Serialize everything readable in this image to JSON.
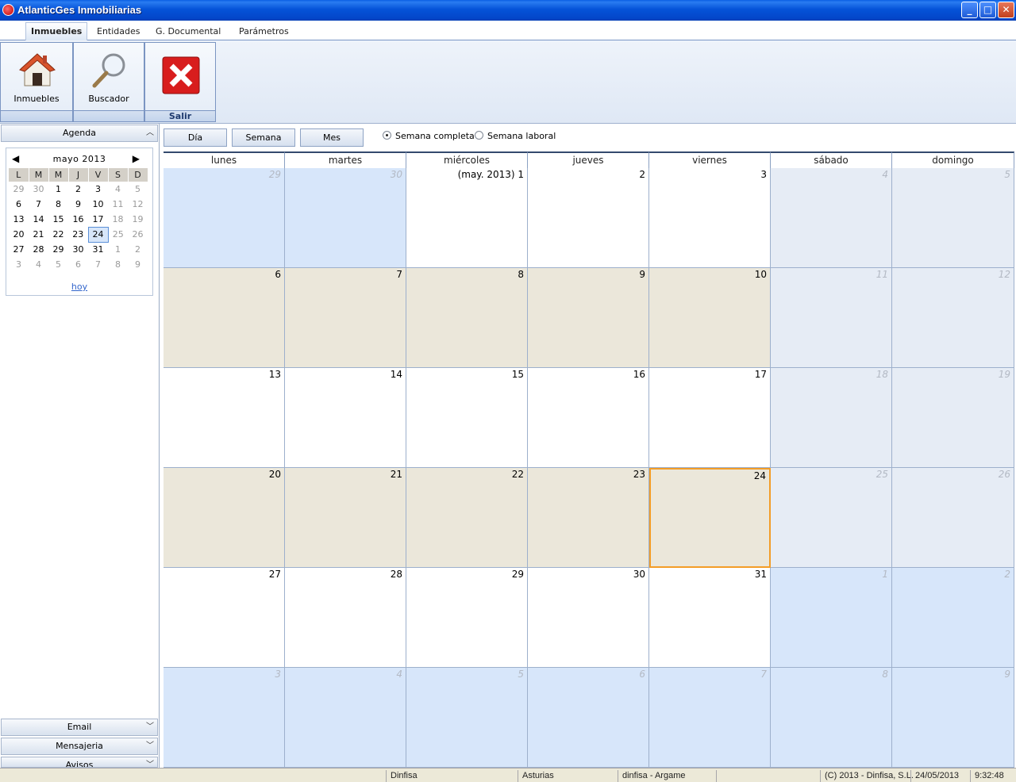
{
  "window": {
    "title": "AtlanticGes Inmobiliarias",
    "minimize": "_",
    "maximize": "□",
    "close": "✕"
  },
  "menu": [
    "Inmuebles",
    "Entidades",
    "G. Documental",
    "Parámetros"
  ],
  "ribbon": {
    "inmuebles_label": "Inmuebles",
    "buscador_label": "Buscador",
    "salir_group": "Salir"
  },
  "sidebar": {
    "agenda_title": "Agenda",
    "panels": [
      "Email",
      "Mensajeria",
      "Avisos"
    ],
    "minical": {
      "month_label": "mayo 2013",
      "weekdays": [
        "L",
        "M",
        "M",
        "J",
        "V",
        "S",
        "D"
      ],
      "weeks": [
        [
          "29",
          "30",
          "1",
          "2",
          "3",
          "4",
          "5"
        ],
        [
          "6",
          "7",
          "8",
          "9",
          "10",
          "11",
          "12"
        ],
        [
          "13",
          "14",
          "15",
          "16",
          "17",
          "18",
          "19"
        ],
        [
          "20",
          "21",
          "22",
          "23",
          "24",
          "25",
          "26"
        ],
        [
          "27",
          "28",
          "29",
          "30",
          "31",
          "1",
          "2"
        ],
        [
          "3",
          "4",
          "5",
          "6",
          "7",
          "8",
          "9"
        ]
      ],
      "today_label": "hoy"
    }
  },
  "toolbar": {
    "views": [
      "Día",
      "Semana",
      "Mes"
    ],
    "radio_full": "Semana completa",
    "radio_work": "Semana laboral",
    "selected": "Semana completa"
  },
  "calendar": {
    "day_headers": [
      "lunes",
      "martes",
      "miércoles",
      "jueves",
      "viernes",
      "sábado",
      "domingo"
    ],
    "weeks": [
      [
        "29",
        "30",
        "(may. 2013) 1",
        "2",
        "3",
        "4",
        "5"
      ],
      [
        "6",
        "7",
        "8",
        "9",
        "10",
        "11",
        "12"
      ],
      [
        "13",
        "14",
        "15",
        "16",
        "17",
        "18",
        "19"
      ],
      [
        "20",
        "21",
        "22",
        "23",
        "24",
        "25",
        "26"
      ],
      [
        "27",
        "28",
        "29",
        "30",
        "31",
        "1",
        "2"
      ],
      [
        "3",
        "4",
        "5",
        "6",
        "7",
        "8",
        "9"
      ]
    ],
    "today": "24"
  },
  "status": [
    "Dinfisa",
    "Asturias",
    "dinfisa - Argame",
    "(C) 2013 - Dinfisa, S.L.",
    "24/05/2013",
    "9:32:48"
  ],
  "colors": {
    "inmonth_white": "#ffffff",
    "inmonth_tan": "#ebe7da",
    "outmonth": "#d7e6fa",
    "weekend": "#e6ecf5",
    "today_border": "#f39d27"
  }
}
